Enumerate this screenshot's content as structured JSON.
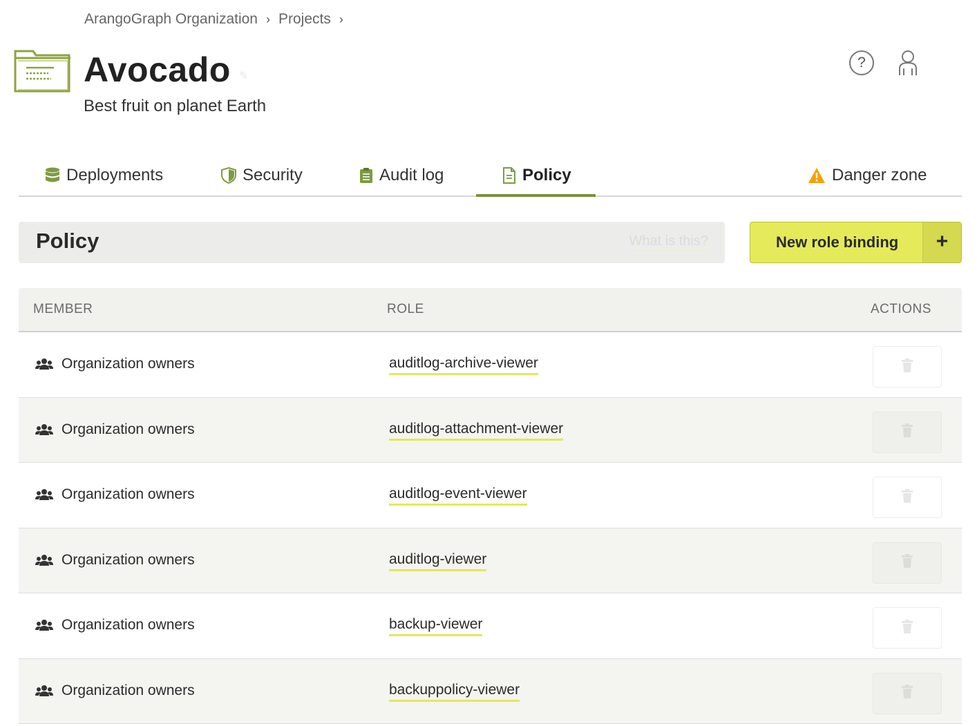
{
  "breadcrumb": [
    {
      "label": "ArangoGraph Organization"
    },
    {
      "label": "Projects"
    }
  ],
  "project": {
    "title": "Avocado",
    "description": "Best fruit on planet Earth"
  },
  "header_icons": {
    "help": "?"
  },
  "tabs": [
    {
      "label": "Deployments",
      "icon": "database-icon"
    },
    {
      "label": "Security",
      "icon": "shield-icon"
    },
    {
      "label": "Audit log",
      "icon": "clipboard-icon"
    },
    {
      "label": "Policy",
      "icon": "document-icon",
      "active": true
    },
    {
      "label": "Danger zone",
      "icon": "warning-icon"
    }
  ],
  "policy": {
    "title": "Policy",
    "help_link": "What is this?",
    "new_button": "New role binding",
    "new_button_icon": "+"
  },
  "table": {
    "columns": [
      "MEMBER",
      "ROLE",
      "ACTIONS"
    ],
    "rows": [
      {
        "member": "Organization owners",
        "role": "auditlog-archive-viewer"
      },
      {
        "member": "Organization owners",
        "role": "auditlog-attachment-viewer"
      },
      {
        "member": "Organization owners",
        "role": "auditlog-event-viewer"
      },
      {
        "member": "Organization owners",
        "role": "auditlog-viewer"
      },
      {
        "member": "Organization owners",
        "role": "backup-viewer"
      },
      {
        "member": "Organization owners",
        "role": "backuppolicy-viewer"
      }
    ]
  },
  "colors": {
    "accent": "#78913f",
    "button": "#e4ea5a",
    "warning": "#f5a100"
  }
}
